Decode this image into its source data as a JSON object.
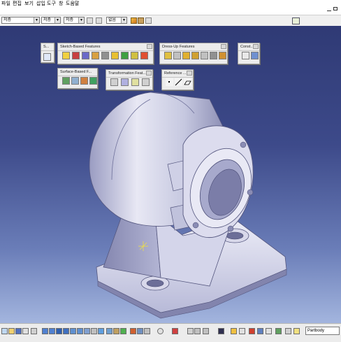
{
  "menu": {
    "items": [
      {
        "label": "파일"
      },
      {
        "label": "편집"
      },
      {
        "label": "보기"
      },
      {
        "label": "삽입"
      },
      {
        "label": "도구"
      },
      {
        "label": "창"
      },
      {
        "label": "도움말"
      }
    ]
  },
  "propbar": {
    "combos": [
      {
        "value": "저층"
      },
      {
        "value": "저층"
      },
      {
        "value": "저층"
      },
      {
        "value": "없음"
      }
    ]
  },
  "toolbars": {
    "sketcher": {
      "title": "S..."
    },
    "sketch_based": {
      "title": "Sketch-Based Features"
    },
    "dress_up": {
      "title": "Dress-Up Features"
    },
    "const": {
      "title": "Const..."
    },
    "surface_based": {
      "title": "Surface-Based F..."
    },
    "transformation": {
      "title": "Transformation Feat..."
    },
    "reference": {
      "title": "Reference ..."
    }
  },
  "statusbar": {
    "command_placeholder": "Partbody"
  },
  "colors": {
    "viewport_top": "#2f3a75",
    "viewport_bottom": "#a3b5de",
    "part_face": "#e6e6f2",
    "part_shadow": "#8d90b8"
  },
  "icons": {
    "sketch_based": [
      "pad-icon",
      "pocket-icon",
      "shaft-icon",
      "groove-icon",
      "hole-icon",
      "rib-icon",
      "slot-icon",
      "stiffener-icon",
      "multi-section-icon"
    ],
    "dress_up": [
      "fillet-icon",
      "chamfer-icon",
      "draft-icon",
      "shell-icon",
      "thickness-icon",
      "thread-icon",
      "remove-face-icon"
    ],
    "transformation": [
      "translate-icon",
      "mirror-icon",
      "pattern-icon",
      "scale-icon"
    ],
    "reference": [
      "point-icon",
      "line-icon",
      "plane-icon"
    ],
    "surface_based": [
      "split-icon",
      "thick-surface-icon",
      "close-surface-icon",
      "sew-surface-icon"
    ]
  }
}
